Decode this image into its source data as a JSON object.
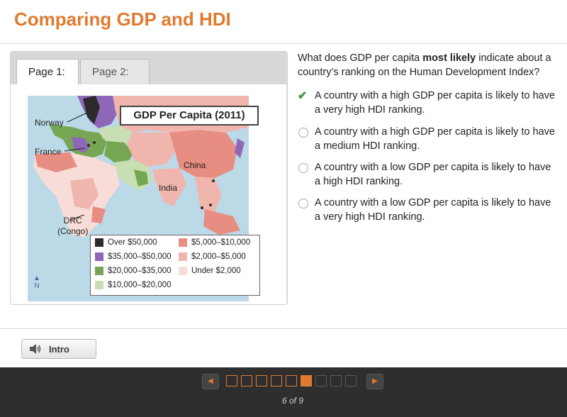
{
  "header": {
    "title": "Comparing GDP and HDI"
  },
  "tabs": [
    {
      "label": "Page 1:",
      "active": true
    },
    {
      "label": "Page 2:",
      "active": false
    }
  ],
  "map": {
    "title": "GDP Per Capita (2011)",
    "labels": {
      "norway": "Norway",
      "france": "France",
      "china": "China",
      "india": "India",
      "drc_line1": "DRC",
      "drc_line2": "(Congo)"
    },
    "north": "N",
    "legend": [
      {
        "label": "Over $50,000",
        "color": "#2b2b2b"
      },
      {
        "label": "$35,000–$50,000",
        "color": "#8e67b8"
      },
      {
        "label": "$20,000–$35,000",
        "color": "#76a653"
      },
      {
        "label": "$10,000–$20,000",
        "color": "#c7dfb3"
      },
      {
        "label": "$5,000–$10,000",
        "color": "#e88d82"
      },
      {
        "label": "$2,000–$5,000",
        "color": "#f0b6ae"
      },
      {
        "label": "Under $2,000",
        "color": "#f8dcd7"
      }
    ]
  },
  "question": {
    "prefix": "What does GDP per capita ",
    "emphasis": "most likely",
    "suffix": " indicate about a country’s ranking on the Human Development Index?"
  },
  "options": [
    {
      "text": "A country with a high GDP per capita is likely to have a very high HDI ranking.",
      "selected": true
    },
    {
      "text": "A country with a high GDP per capita is likely to have a medium HDI ranking.",
      "selected": false
    },
    {
      "text": "A country with a low GDP per capita is likely to have a high HDI ranking.",
      "selected": false
    },
    {
      "text": "A country with a low GDP per capita is likely to have a very high HDI ranking.",
      "selected": false
    }
  ],
  "toolbar": {
    "intro_label": "Intro"
  },
  "footer": {
    "page_count": "6 of 9",
    "current_page": 6,
    "total_pages": 9
  },
  "colors": {
    "accent": "#e07a2f",
    "check": "#3f8f3a",
    "footer_bg": "#2e2e2e"
  }
}
